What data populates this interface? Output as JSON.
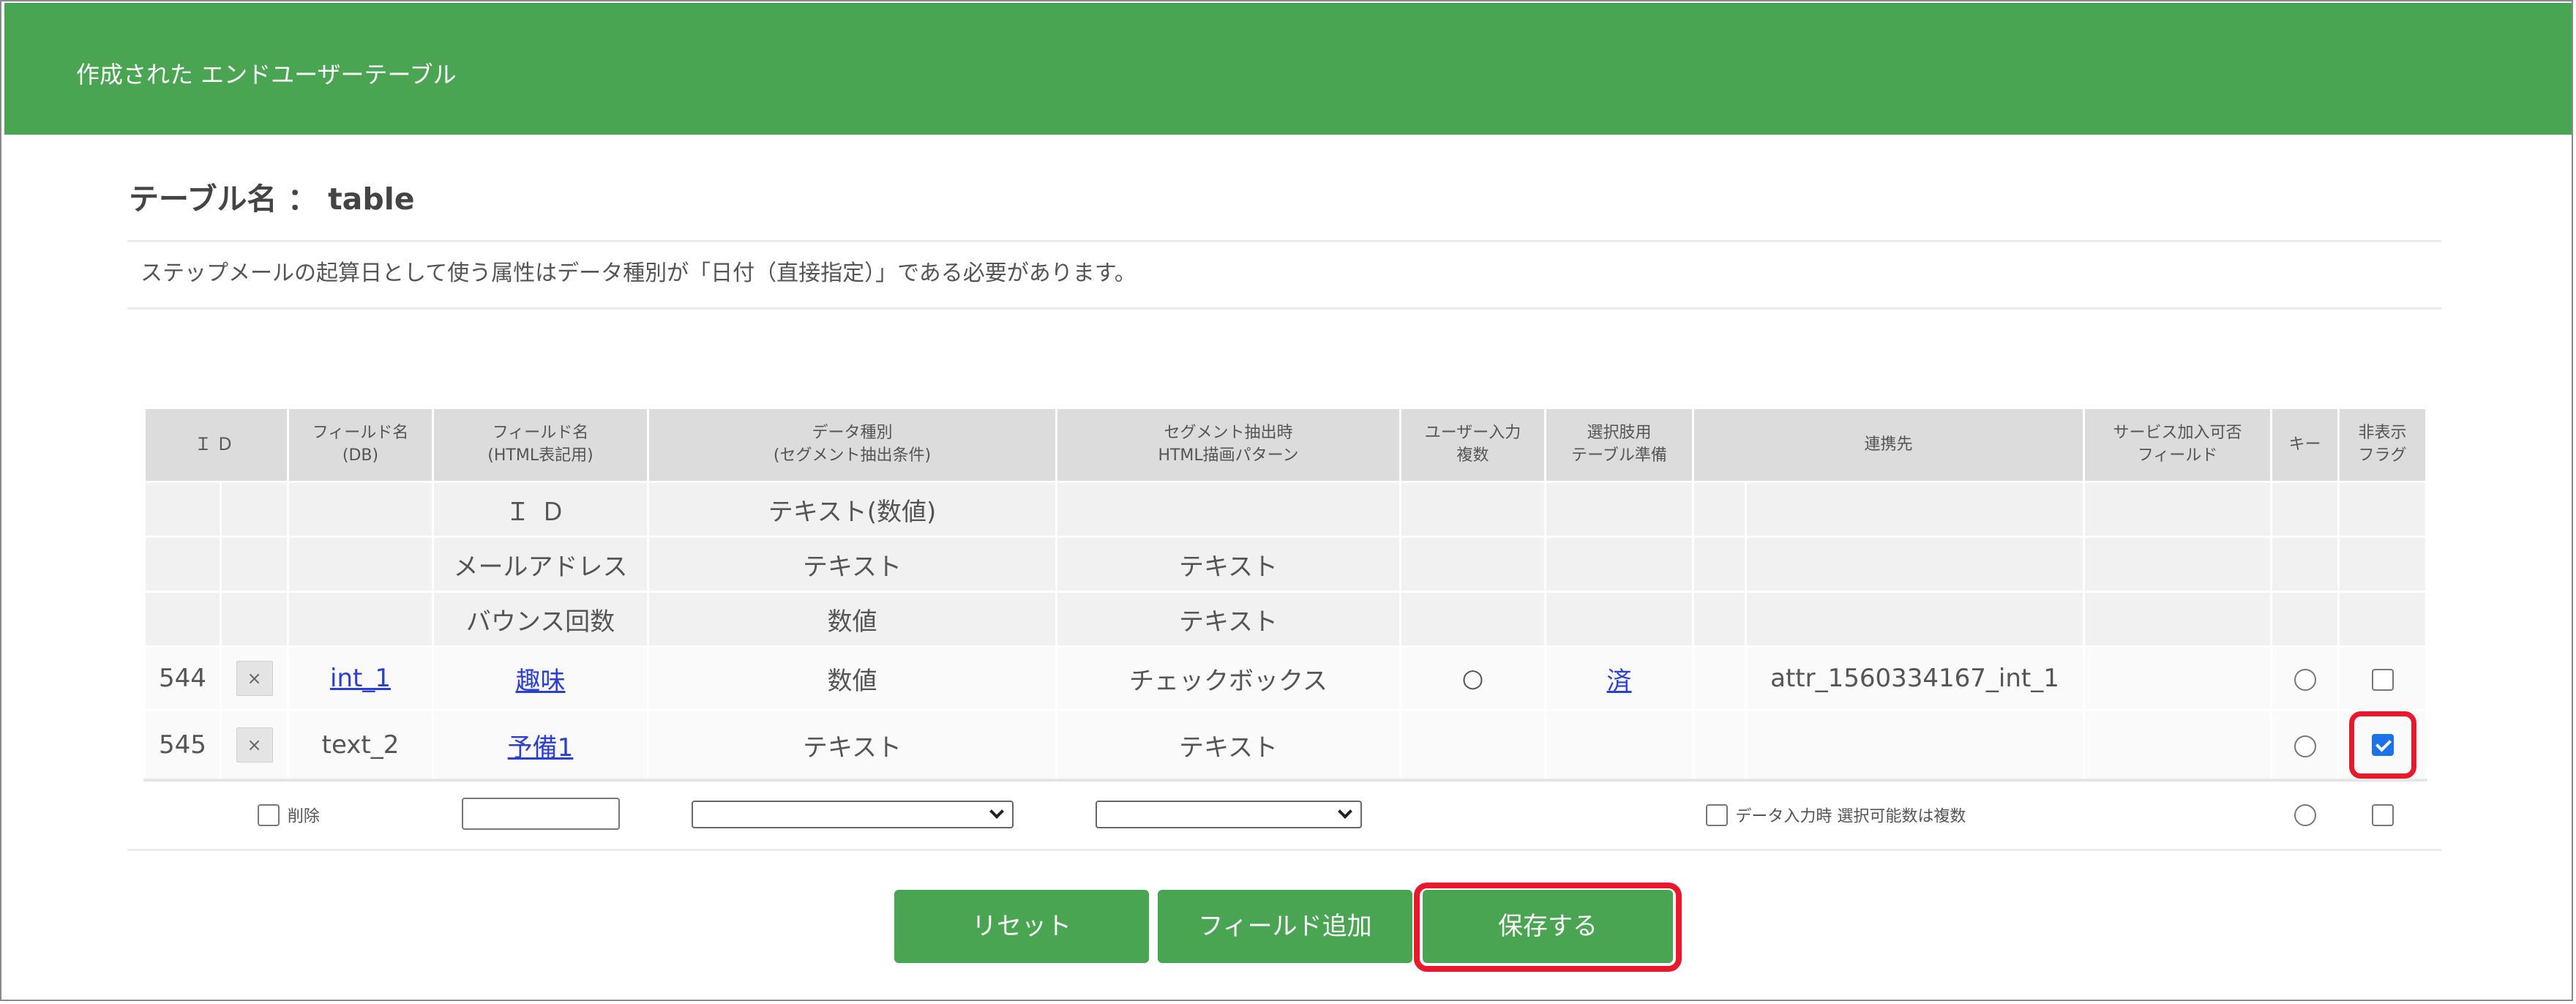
{
  "header": {
    "title": "作成された エンドユーザーテーブル"
  },
  "table_name_label": "テーブル名 ： table",
  "notice": "ステップメールの起算日として使う属性はデータ種別が「日付（直接指定）」である必要があります。",
  "columns": {
    "id": "ＩＤ",
    "field_db": [
      "フィールド名",
      "(DB)"
    ],
    "field_html": [
      "フィールド名",
      "(HTML表記用)"
    ],
    "data_type": [
      "データ種別",
      "(セグメント抽出条件)"
    ],
    "segment": [
      "セグメント抽出時",
      "HTML描画パターン"
    ],
    "user_input": [
      "ユーザー入力",
      "複数"
    ],
    "select_table": [
      "選択肢用",
      "テーブル準備"
    ],
    "link": "連携先",
    "service": [
      "サービス加入可否",
      "フィールド"
    ],
    "key": "キー",
    "hidden": [
      "非表示",
      "フラグ"
    ]
  },
  "system_rows": [
    {
      "field_html": "ＩＤ",
      "data_type": "テキスト(数値)",
      "segment": ""
    },
    {
      "field_html": "メールアドレス",
      "data_type": "テキスト",
      "segment": "テキスト"
    },
    {
      "field_html": "バウンス回数",
      "data_type": "数値",
      "segment": "テキスト"
    }
  ],
  "user_rows": [
    {
      "id": "544",
      "delete": "×",
      "field_db": "int_1",
      "field_html": "趣味",
      "data_type": "数値",
      "segment": "チェックボックス",
      "user_input": "○",
      "select_table": "済",
      "link": "attr_1560334167_int_1",
      "hidden_checked": false
    },
    {
      "id": "545",
      "delete": "×",
      "field_db": "text_2",
      "field_html": "予備1",
      "data_type": "テキスト",
      "segment": "テキスト",
      "user_input": "",
      "select_table": "",
      "link": "",
      "hidden_checked": true
    }
  ],
  "add_row": {
    "delete_label": "削除",
    "field_name_value": "",
    "data_type_value": "",
    "segment_value": "",
    "multi_label": "データ入力時 選択可能数は複数"
  },
  "buttons": {
    "reset": "リセット",
    "add_field": "フィールド追加",
    "save": "保存する"
  },
  "colors": {
    "header_green": "#4aa552",
    "highlight_red": "#e8192c",
    "link_blue": "#2b3fd1"
  }
}
